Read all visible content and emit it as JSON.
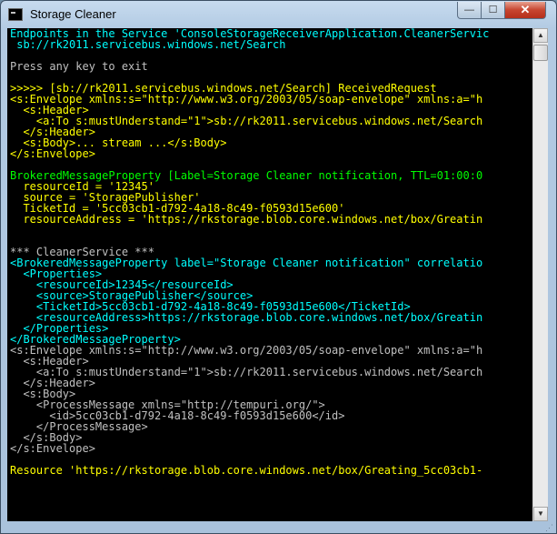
{
  "window": {
    "title": "Storage Cleaner",
    "controls": {
      "minimize": "—",
      "maximize": "☐",
      "close": "✕"
    }
  },
  "colors": {
    "cyan": "#00ffff",
    "gray": "#c0c0c0",
    "yellow": "#ffff00",
    "green": "#00ff00"
  },
  "console": {
    "lines": [
      {
        "text": "Endpoints in the Service 'ConsoleStorageReceiverApplication.CleanerServic",
        "color": "cyan"
      },
      {
        "text": " sb://rk2011.servicebus.windows.net/Search",
        "color": "cyan"
      },
      {
        "text": "",
        "color": "gray"
      },
      {
        "text": "Press any key to exit",
        "color": "gray"
      },
      {
        "text": "",
        "color": "gray"
      },
      {
        "text": ">>>>> [sb://rk2011.servicebus.windows.net/Search] ReceivedRequest",
        "color": "yellow"
      },
      {
        "text": "<s:Envelope xmlns:s=\"http://www.w3.org/2003/05/soap-envelope\" xmlns:a=\"h",
        "color": "yellow"
      },
      {
        "text": "  <s:Header>",
        "color": "yellow"
      },
      {
        "text": "    <a:To s:mustUnderstand=\"1\">sb://rk2011.servicebus.windows.net/Search",
        "color": "yellow"
      },
      {
        "text": "  </s:Header>",
        "color": "yellow"
      },
      {
        "text": "  <s:Body>... stream ...</s:Body>",
        "color": "yellow"
      },
      {
        "text": "</s:Envelope>",
        "color": "yellow"
      },
      {
        "text": "",
        "color": "gray"
      },
      {
        "text": "BrokeredMessageProperty [Label=Storage Cleaner notification, TTL=01:00:0",
        "color": "green"
      },
      {
        "text": "  resourceId = '12345'",
        "color": "yellow"
      },
      {
        "text": "  source = 'StoragePublisher'",
        "color": "yellow"
      },
      {
        "text": "  TicketId = '5cc03cb1-d792-4a18-8c49-f0593d15e600'",
        "color": "yellow"
      },
      {
        "text": "  resourceAddress = 'https://rkstorage.blob.core.windows.net/box/Greatin",
        "color": "yellow"
      },
      {
        "text": "",
        "color": "gray"
      },
      {
        "text": "",
        "color": "gray"
      },
      {
        "text": "*** CleanerService ***",
        "color": "gray"
      },
      {
        "text": "<BrokeredMessageProperty label=\"Storage Cleaner notification\" correlatio",
        "color": "cyan"
      },
      {
        "text": "  <Properties>",
        "color": "cyan"
      },
      {
        "text": "    <resourceId>12345</resourceId>",
        "color": "cyan"
      },
      {
        "text": "    <source>StoragePublisher</source>",
        "color": "cyan"
      },
      {
        "text": "    <TicketId>5cc03cb1-d792-4a18-8c49-f0593d15e600</TicketId>",
        "color": "cyan"
      },
      {
        "text": "    <resourceAddress>https://rkstorage.blob.core.windows.net/box/Greatin",
        "color": "cyan"
      },
      {
        "text": "  </Properties>",
        "color": "cyan"
      },
      {
        "text": "</BrokeredMessageProperty>",
        "color": "cyan"
      },
      {
        "text": "<s:Envelope xmlns:s=\"http://www.w3.org/2003/05/soap-envelope\" xmlns:a=\"h",
        "color": "gray"
      },
      {
        "text": "  <s:Header>",
        "color": "gray"
      },
      {
        "text": "    <a:To s:mustUnderstand=\"1\">sb://rk2011.servicebus.windows.net/Search",
        "color": "gray"
      },
      {
        "text": "  </s:Header>",
        "color": "gray"
      },
      {
        "text": "  <s:Body>",
        "color": "gray"
      },
      {
        "text": "    <ProcessMessage xmlns=\"http://tempuri.org/\">",
        "color": "gray"
      },
      {
        "text": "      <id>5cc03cb1-d792-4a18-8c49-f0593d15e600</id>",
        "color": "gray"
      },
      {
        "text": "    </ProcessMessage>",
        "color": "gray"
      },
      {
        "text": "  </s:Body>",
        "color": "gray"
      },
      {
        "text": "</s:Envelope>",
        "color": "gray"
      },
      {
        "text": "",
        "color": "gray"
      },
      {
        "text": "Resource 'https://rkstorage.blob.core.windows.net/box/Greating_5cc03cb1-",
        "color": "yellow"
      }
    ]
  },
  "scrollbar": {
    "up_arrow": "▲",
    "down_arrow": "▼"
  }
}
